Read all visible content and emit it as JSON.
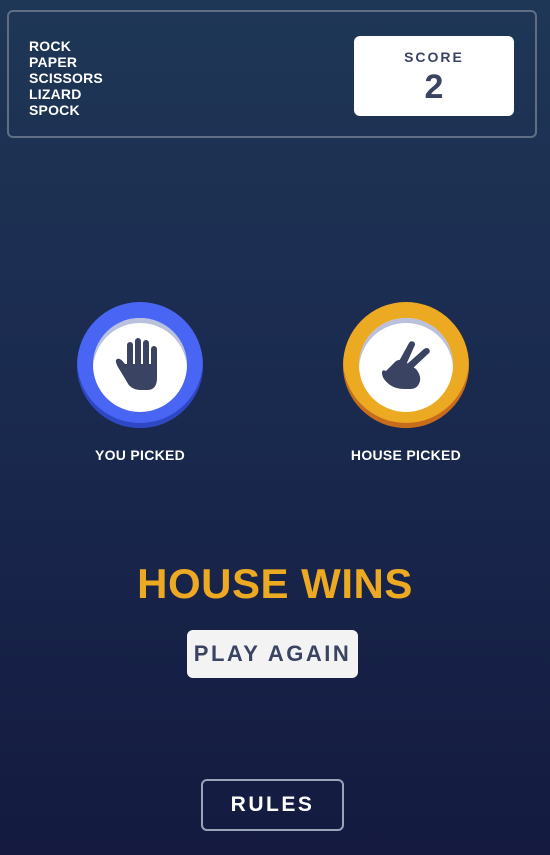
{
  "header": {
    "logo_lines": [
      "ROCK",
      "PAPER",
      "SCISSORS",
      "LIZARD",
      "SPOCK"
    ],
    "score_label": "SCORE",
    "score_value": "2"
  },
  "game": {
    "you_picked_label": "YOU PICKED",
    "house_picked_label": "HOUSE PICKED",
    "you_choice": "paper",
    "house_choice": "scissors",
    "you_choice_icon": "hand-paper-icon",
    "house_choice_icon": "hand-scissors-icon",
    "result_text": "HOUSE WINS",
    "play_again_label": "PLAY AGAIN"
  },
  "footer": {
    "rules_label": "RULES"
  },
  "colors": {
    "paper_ring": "#4865f4",
    "scissors_ring": "#eca922",
    "result_text": "#eca922",
    "icon_fill": "#3b4363"
  }
}
